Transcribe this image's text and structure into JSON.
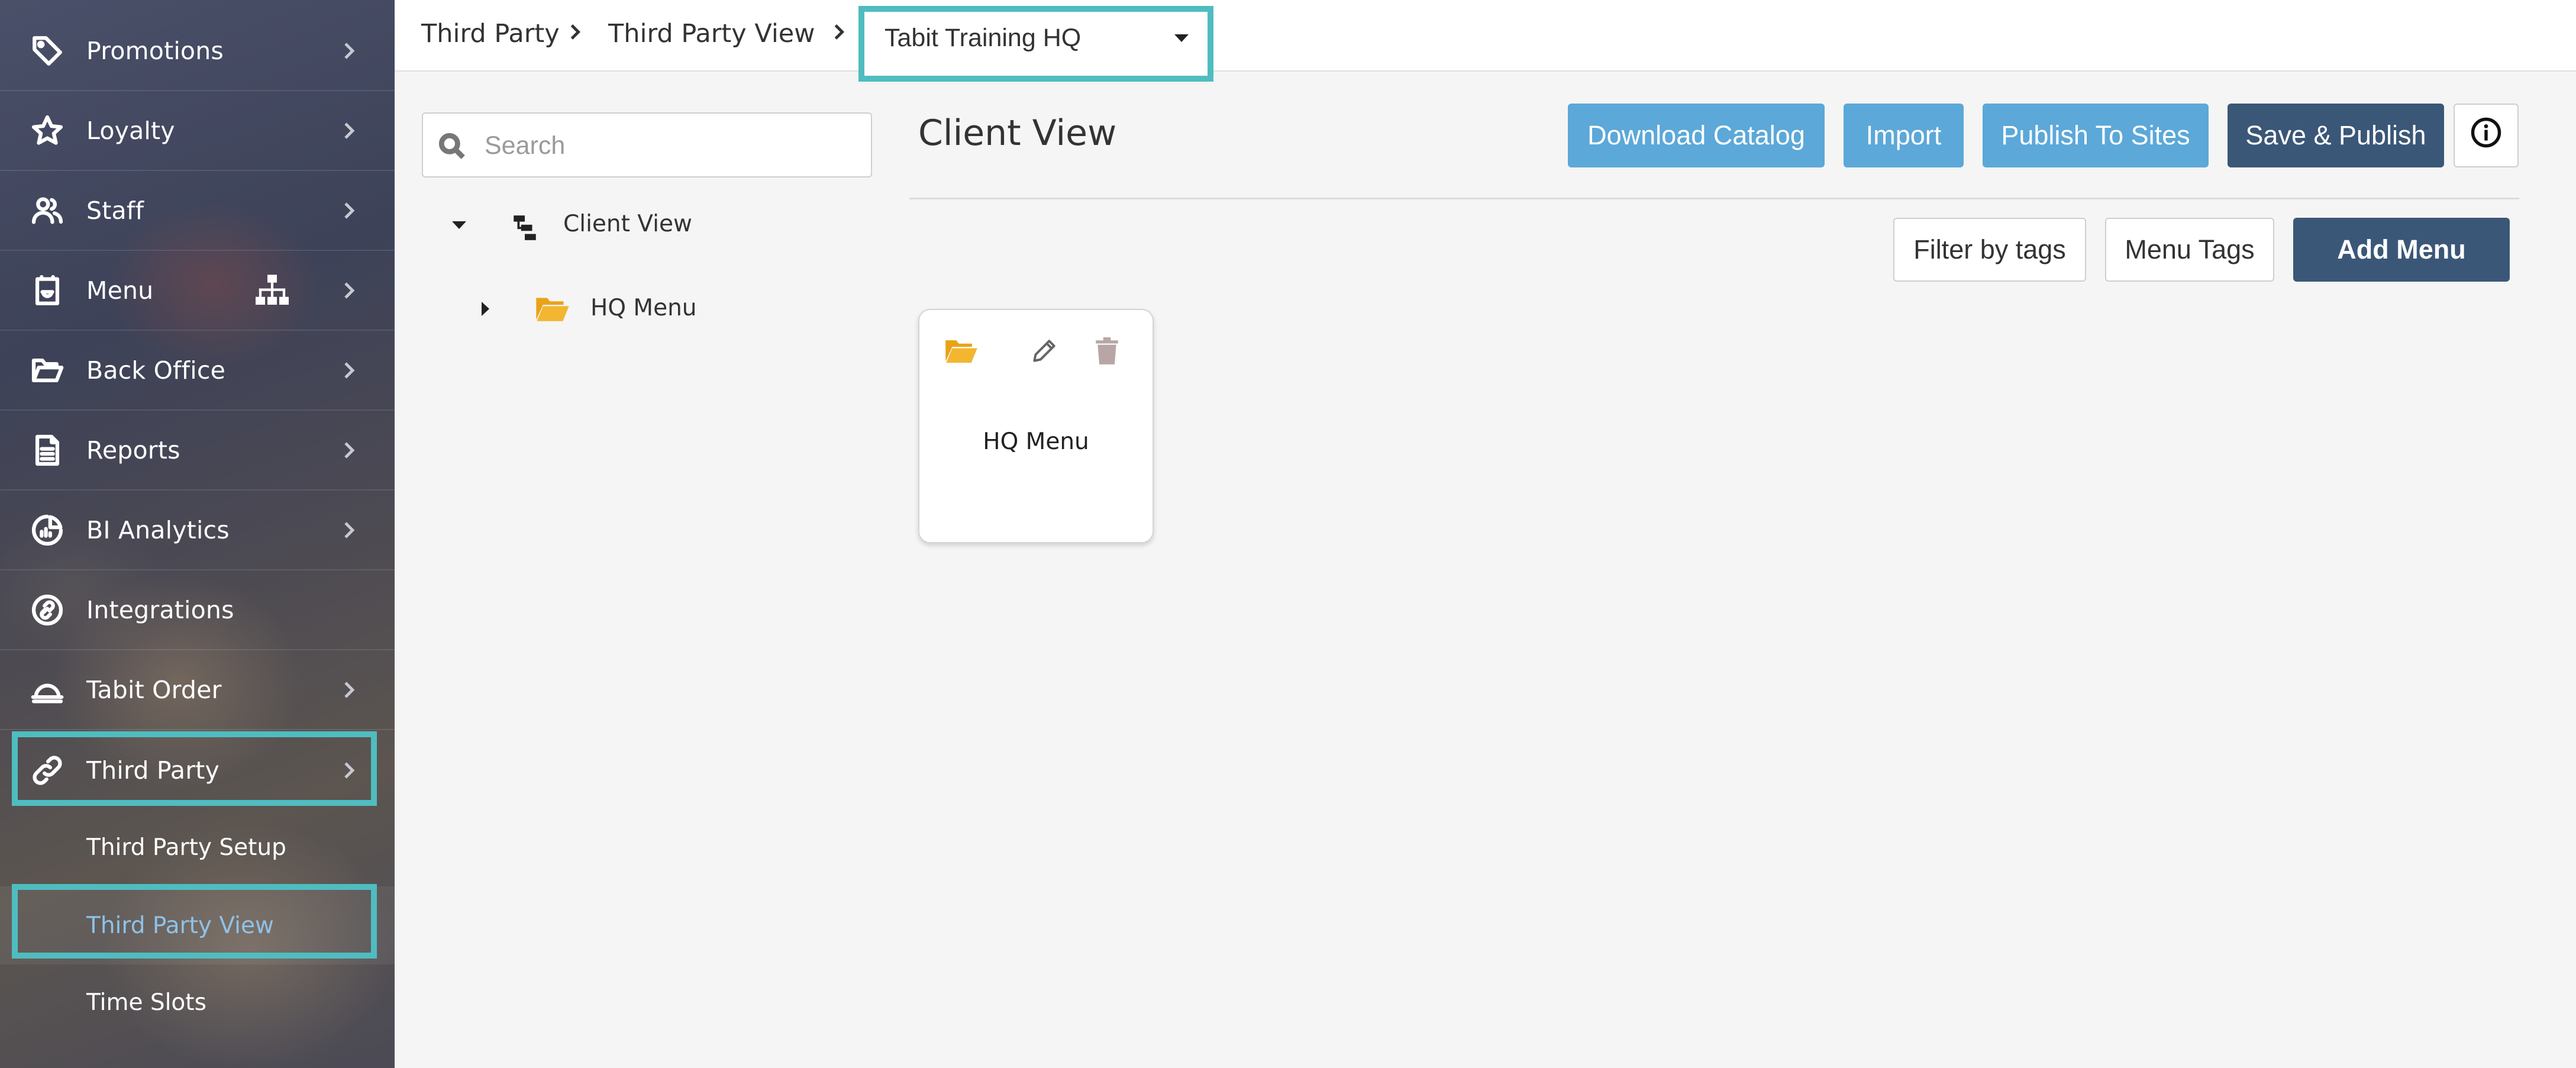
{
  "sidebar": {
    "items": [
      {
        "label": "Promotions",
        "icon": "tag-icon"
      },
      {
        "label": "Loyalty",
        "icon": "star-icon"
      },
      {
        "label": "Staff",
        "icon": "users-icon"
      },
      {
        "label": "Menu",
        "icon": "menu-icon",
        "extra_icon": "sitemap-icon"
      },
      {
        "label": "Back Office",
        "icon": "folder-open-icon"
      },
      {
        "label": "Reports",
        "icon": "document-icon"
      },
      {
        "label": "BI Analytics",
        "icon": "analytics-icon"
      },
      {
        "label": "Integrations",
        "icon": "integrations-icon"
      },
      {
        "label": "Tabit Order",
        "icon": "cloche-icon"
      },
      {
        "label": "Third Party",
        "icon": "link-icon"
      }
    ],
    "subitems": [
      {
        "label": "Third Party Setup"
      },
      {
        "label": "Third Party View",
        "active": true
      },
      {
        "label": "Time Slots"
      }
    ]
  },
  "breadcrumb": {
    "items": [
      "Third Party",
      "Third Party View"
    ],
    "site_select": "Tabit Training HQ"
  },
  "tree": {
    "search_placeholder": "Search",
    "root": "Client View",
    "children": [
      "HQ Menu"
    ]
  },
  "main": {
    "title": "Client View",
    "buttons": {
      "download_catalog": "Download Catalog",
      "import": "Import",
      "publish_to_sites": "Publish To Sites",
      "save_publish": "Save & Publish",
      "filter_by_tags": "Filter by tags",
      "menu_tags": "Menu Tags",
      "add_menu": "Add Menu"
    },
    "cards": [
      {
        "label": "HQ Menu"
      }
    ]
  },
  "colors": {
    "highlight": "#4fbdc0",
    "button_light": "#5ca8d8",
    "button_dark": "#3b5777",
    "folder": "#e8a317",
    "active_sub": "#8ec2e8"
  }
}
